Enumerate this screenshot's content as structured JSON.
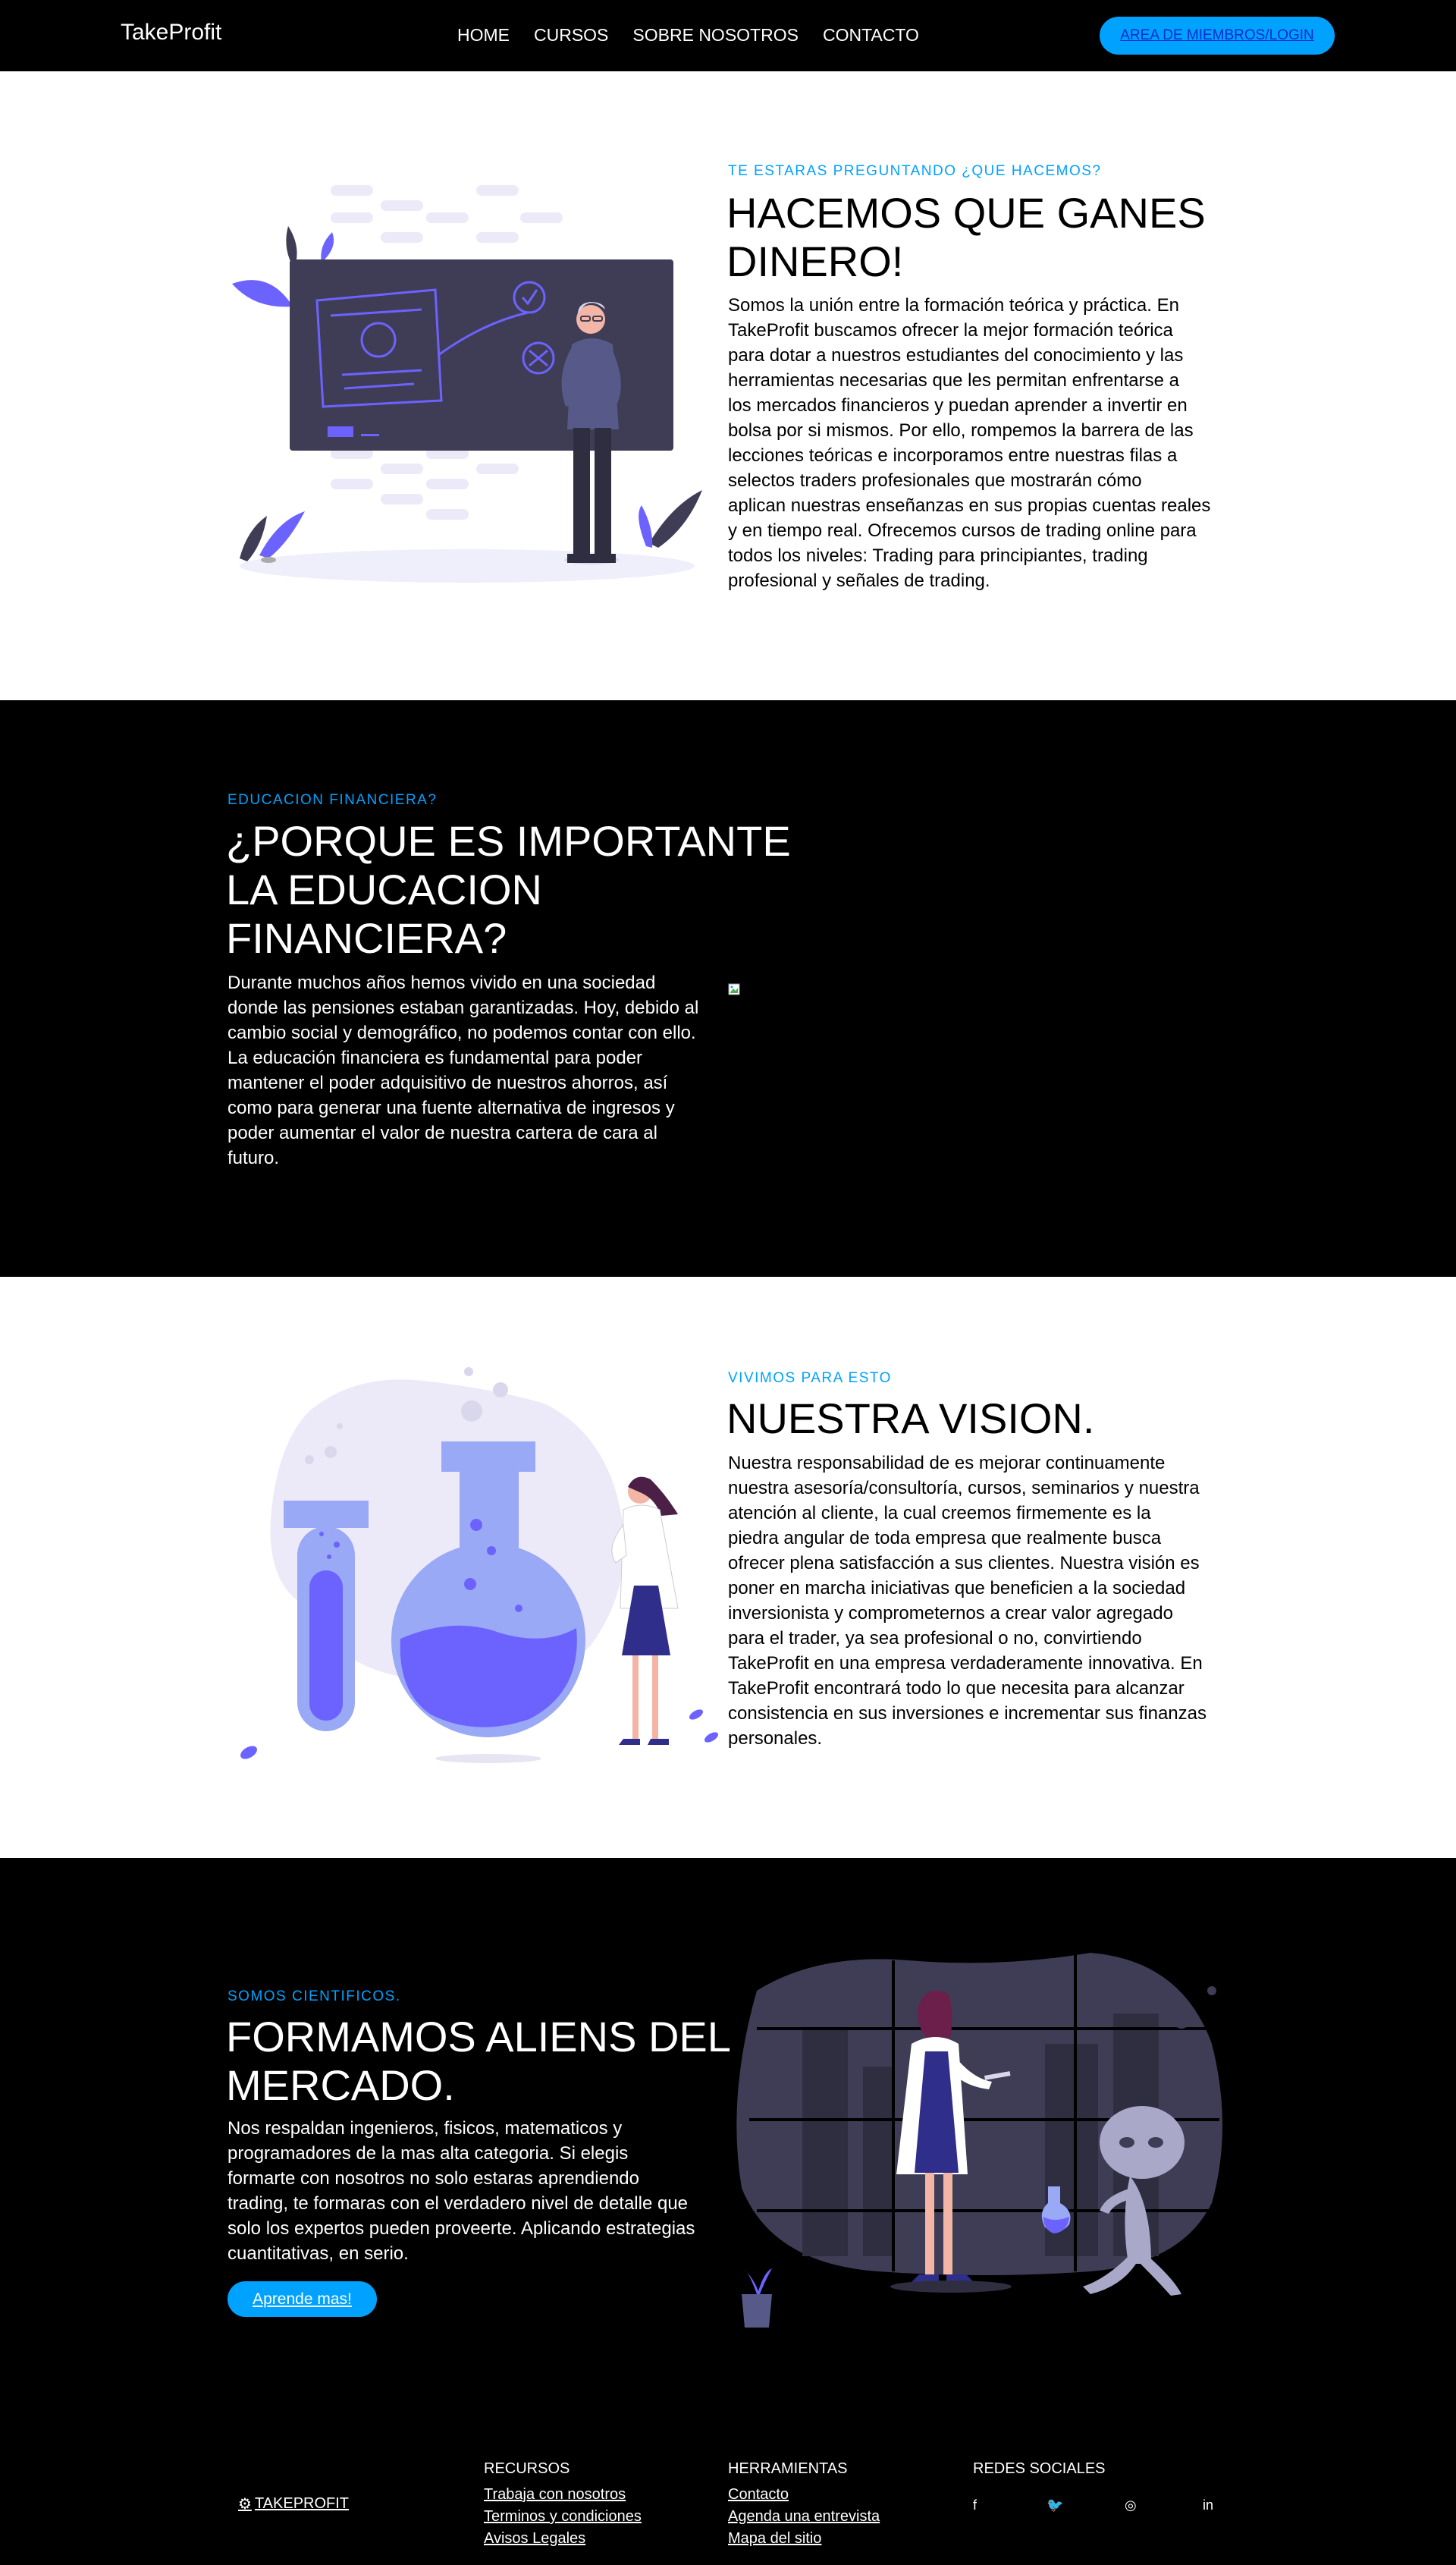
{
  "nav": {
    "brand": "TakeProfit",
    "links": [
      "HOME",
      "CURSOS",
      "SOBRE NOSOTROS",
      "CONTACTO"
    ],
    "login": "AREA DE MIEMBROS/LOGIN"
  },
  "section1": {
    "eyebrow": "TE ESTARAS PREGUNTANDO ¿QUE HACEMOS?",
    "title_line1": "HACEMOS QUE GANES",
    "title_line2": "DINERO!",
    "lines": [
      "Somos la unión entre la formación teórica y práctica. En",
      "TakeProfit buscamos ofrecer la mejor formación teórica",
      "para dotar a nuestros estudiantes del conocimiento y las",
      "herramientas necesarias que les permitan enfrentarse a",
      "los mercados financieros y puedan aprender a invertir en",
      "bolsa por si mismos. Por ello, rompemos la barrera de las",
      "lecciones teóricas e incorporamos entre nuestras filas a",
      "selectos traders profesionales que mostrarán cómo",
      "aplican nuestras enseñanzas en sus propias cuentas reales",
      "y en tiempo real. Ofrecemos cursos de trading online para",
      "todos los niveles: Trading para principiantes, trading",
      "profesional y señales de trading."
    ]
  },
  "section2": {
    "eyebrow": "EDUCACION FINANCIERA?",
    "title_lines": [
      "¿PORQUE ES IMPORTANTE",
      "LA EDUCACION",
      "FINANCIERA?"
    ],
    "lines": [
      "Durante muchos años hemos vivido en una sociedad",
      "donde las pensiones estaban garantizadas. Hoy, debido al",
      "cambio social y demográfico, no podemos contar con ello.",
      "La educación financiera es fundamental para poder",
      "mantener el poder adquisitivo de nuestros ahorros, así",
      "como para generar una fuente alternativa de ingresos y",
      "poder aumentar el valor de nuestra cartera de cara al",
      "futuro."
    ]
  },
  "section3": {
    "eyebrow": "VIVIMOS PARA ESTO",
    "title": "NUESTRA VISION.",
    "lines": [
      "Nuestra responsabilidad de es mejorar continuamente",
      "nuestra asesoría/consultoría, cursos, seminarios y nuestra",
      "atención al cliente, la cual creemos firmemente es la",
      "piedra angular de toda empresa que realmente busca",
      "ofrecer plena satisfacción a sus clientes. Nuestra visión es",
      "poner en marcha iniciativas que beneficien a la sociedad",
      "inversionista y comprometernos a crear valor agregado",
      "para el trader, ya sea profesional o no, convirtiendo",
      "TakeProfit en una empresa verdaderamente innovativa. En",
      "TakeProfit encontrará todo lo que necesita para alcanzar",
      "consistencia en sus inversiones e incrementar sus finanzas",
      "personales."
    ]
  },
  "section4": {
    "eyebrow": "SOMOS CIENTIFICOS.",
    "title_lines": [
      "FORMAMOS ALIENS DEL",
      "MERCADO."
    ],
    "lines": [
      "Nos respaldan ingenieros, fisicos, matematicos y",
      "programadores de la mas alta categoria. Si elegis",
      "formarte con nosotros no solo estaras aprendiendo",
      "trading, te formaras con el verdadero nivel de detalle que",
      "solo los expertos pueden proveerte. Aplicando estrategias",
      "cuantitativas, en serio."
    ],
    "cta": "Aprende mas!"
  },
  "footer": {
    "logo": "TAKEPROFIT",
    "recursos": {
      "title": "RECURSOS",
      "links": [
        "Trabaja con nosotros",
        "Terminos y condiciones",
        "Avisos Legales"
      ]
    },
    "herramientas": {
      "title": "HERRAMIENTAS",
      "links": [
        "Contacto",
        "Agenda una entrevista",
        "Mapa del sitio"
      ]
    },
    "redes": {
      "title": "REDES SOCIALES",
      "icons": [
        "facebook-icon",
        "twitter-icon",
        "instagram-icon",
        "linkedin-icon"
      ],
      "glyphs": [
        "f",
        "🐦",
        "◎",
        "in"
      ]
    }
  },
  "colors": {
    "accent": "#00a2ff",
    "purple": "#6c63ff",
    "dark_board": "#3f3d56"
  }
}
